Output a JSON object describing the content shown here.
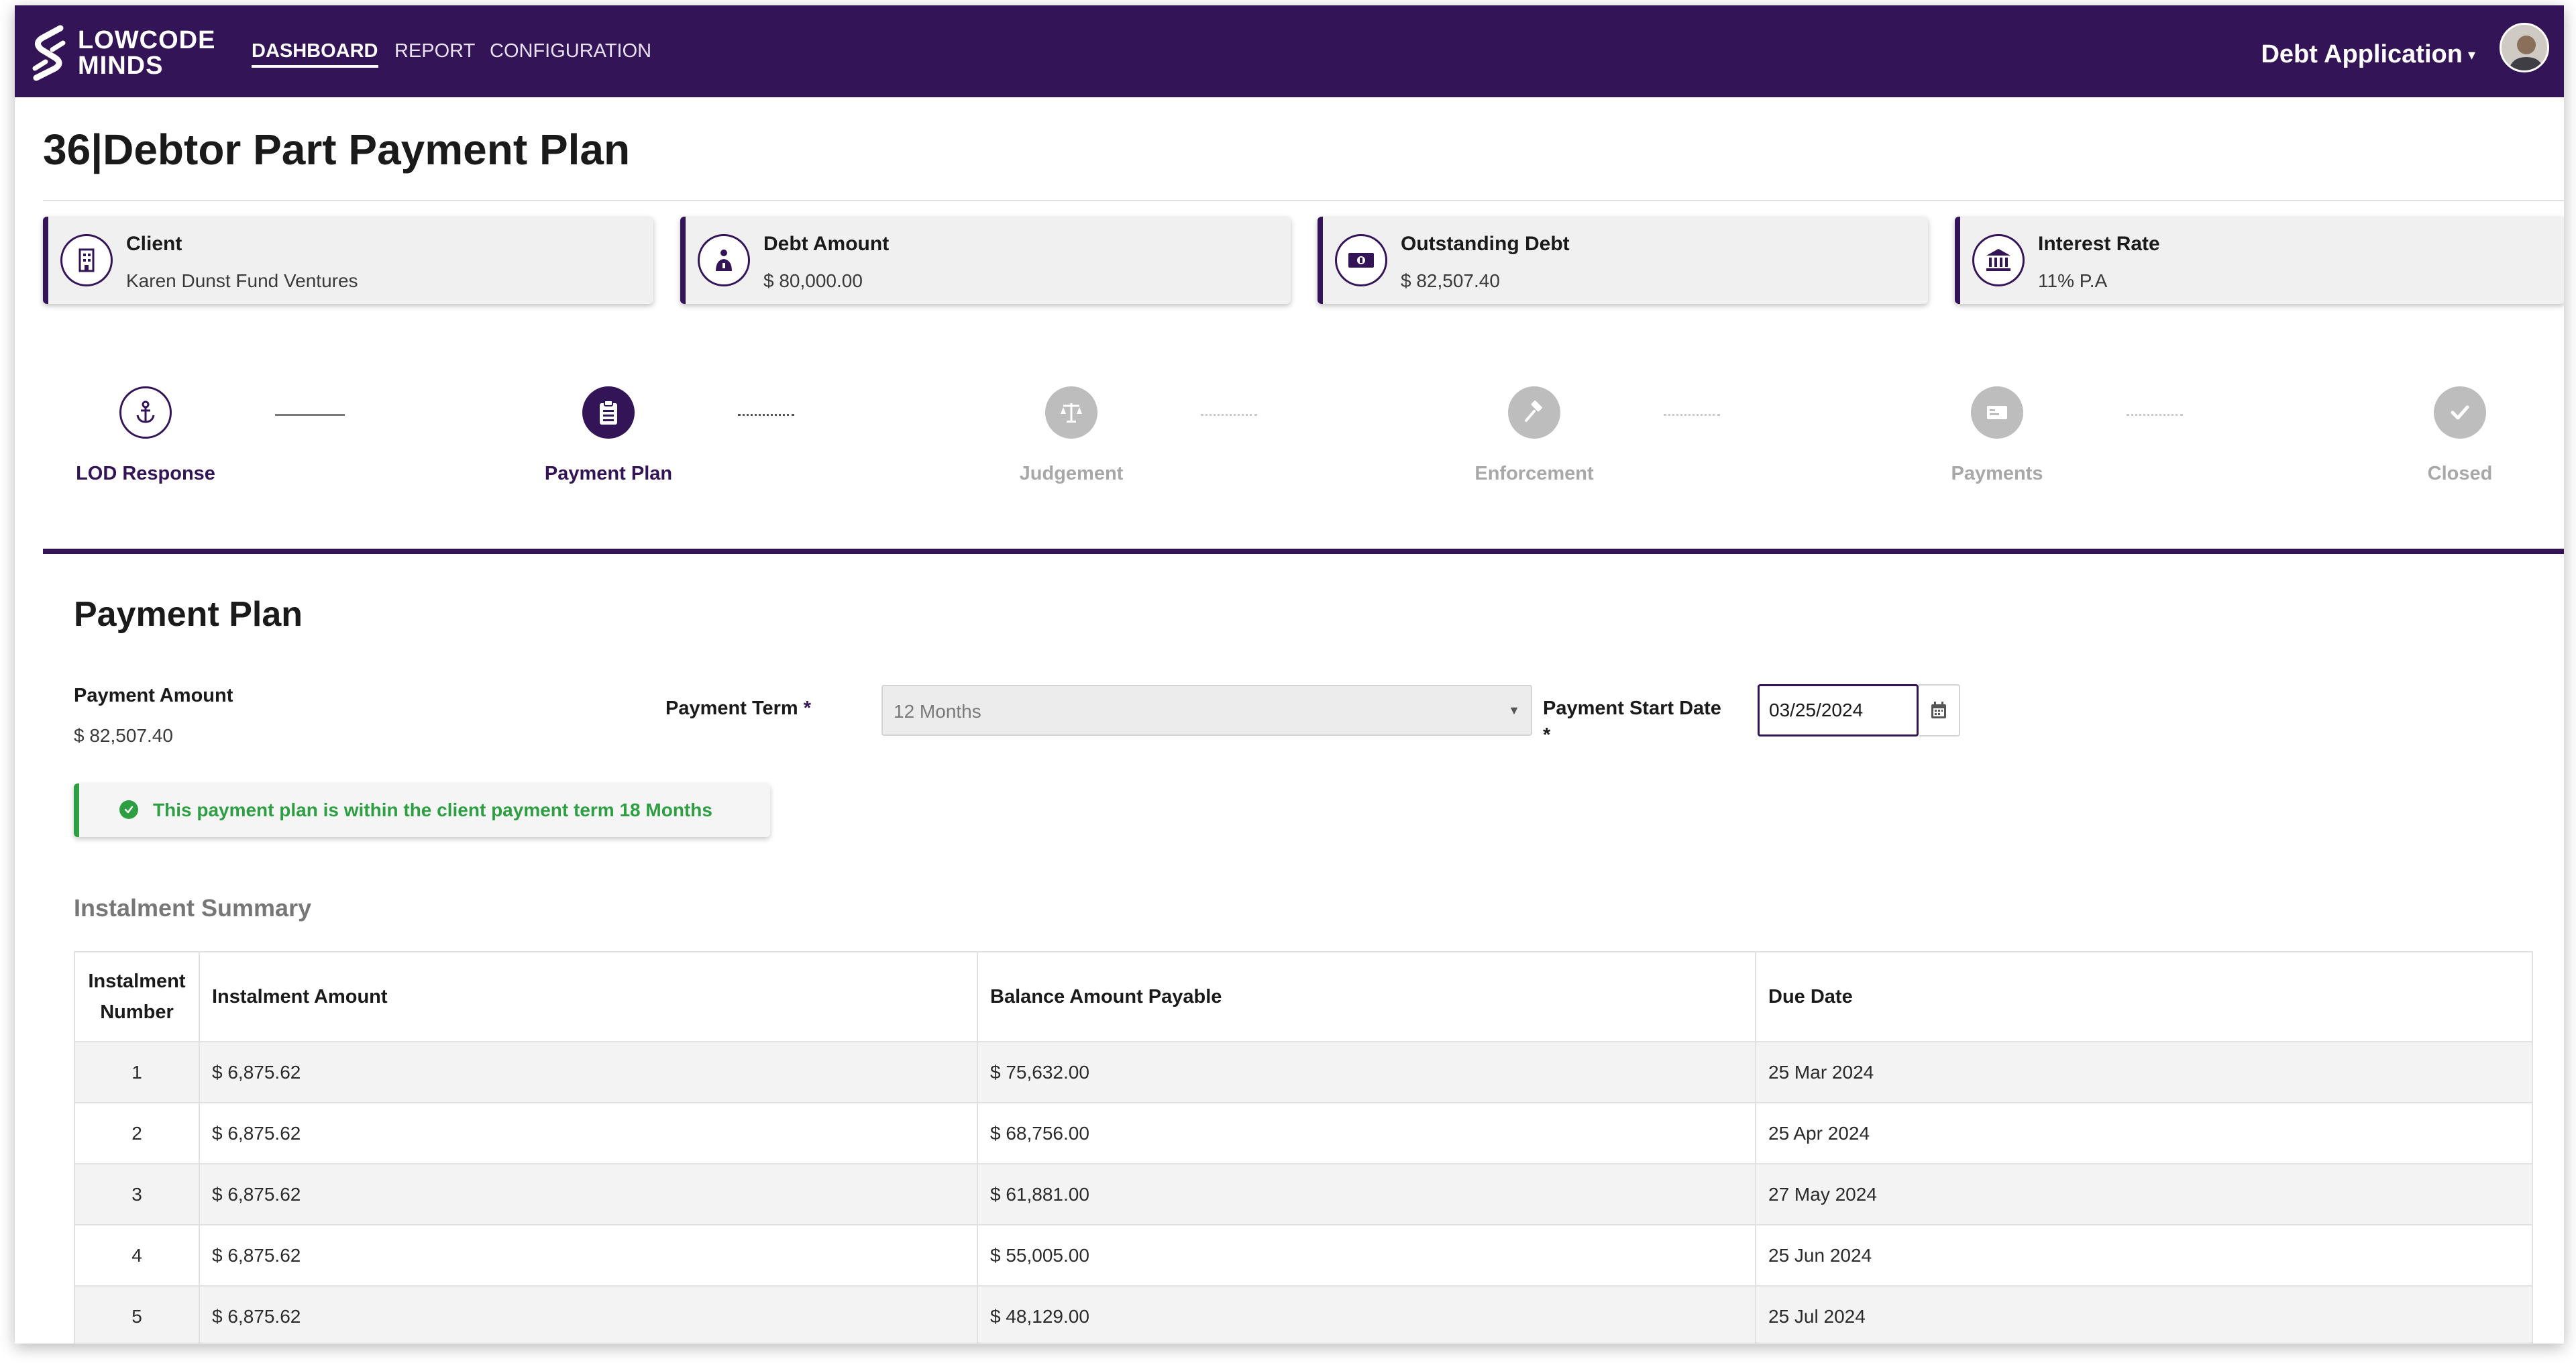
{
  "nav": {
    "logo_line1": "LOWCODE",
    "logo_line2": "MINDS",
    "links": [
      "DASHBOARD",
      "REPORT",
      "CONFIGURATION"
    ],
    "app_menu": "Debt Application"
  },
  "page": {
    "title": "36|Debtor Part Payment Plan"
  },
  "cards": [
    {
      "label": "Client",
      "value": "Karen Dunst Fund Ventures",
      "icon": "building-icon"
    },
    {
      "label": "Debt Amount",
      "value": "$ 80,000.00",
      "icon": "money-bag-icon"
    },
    {
      "label": "Outstanding Debt",
      "value": "$ 82,507.40",
      "icon": "cash-icon"
    },
    {
      "label": "Interest Rate",
      "value": "11% P.A",
      "icon": "bank-icon"
    }
  ],
  "steps": [
    {
      "label": "LOD Response",
      "status": "done",
      "icon": "anchor-icon"
    },
    {
      "label": "Payment Plan",
      "status": "current",
      "icon": "clipboard-icon"
    },
    {
      "label": "Judgement",
      "status": "pending",
      "icon": "scale-icon"
    },
    {
      "label": "Enforcement",
      "status": "pending",
      "icon": "gavel-icon"
    },
    {
      "label": "Payments",
      "status": "pending",
      "icon": "payment-card-icon"
    },
    {
      "label": "Closed",
      "status": "pending",
      "icon": "check-icon"
    }
  ],
  "plan": {
    "title": "Payment Plan",
    "amount_label": "Payment Amount",
    "amount_value": "$ 82,507.40",
    "term_label": "Payment Term",
    "term_value": "12 Months",
    "start_label": "Payment Start Date",
    "start_value": "03/25/2024",
    "required_mark": "*",
    "alert": "This payment plan is within the client payment term 18 Months"
  },
  "summary": {
    "title": "Instalment Summary",
    "headers": [
      "Instalment Number",
      "Instalment Amount",
      "Balance Amount Payable",
      "Due Date"
    ],
    "rows": [
      [
        "1",
        "$ 6,875.62",
        "$ 75,632.00",
        "25 Mar 2024"
      ],
      [
        "2",
        "$ 6,875.62",
        "$ 68,756.00",
        "25 Apr 2024"
      ],
      [
        "3",
        "$ 6,875.62",
        "$ 61,881.00",
        "27 May 2024"
      ],
      [
        "4",
        "$ 6,875.62",
        "$ 55,005.00",
        "25 Jun 2024"
      ],
      [
        "5",
        "$ 6,875.62",
        "$ 48,129.00",
        "25 Jul 2024"
      ]
    ]
  },
  "colors": {
    "brand": "#331456",
    "success": "#2e9e43",
    "muted": "#a8a8a8"
  }
}
